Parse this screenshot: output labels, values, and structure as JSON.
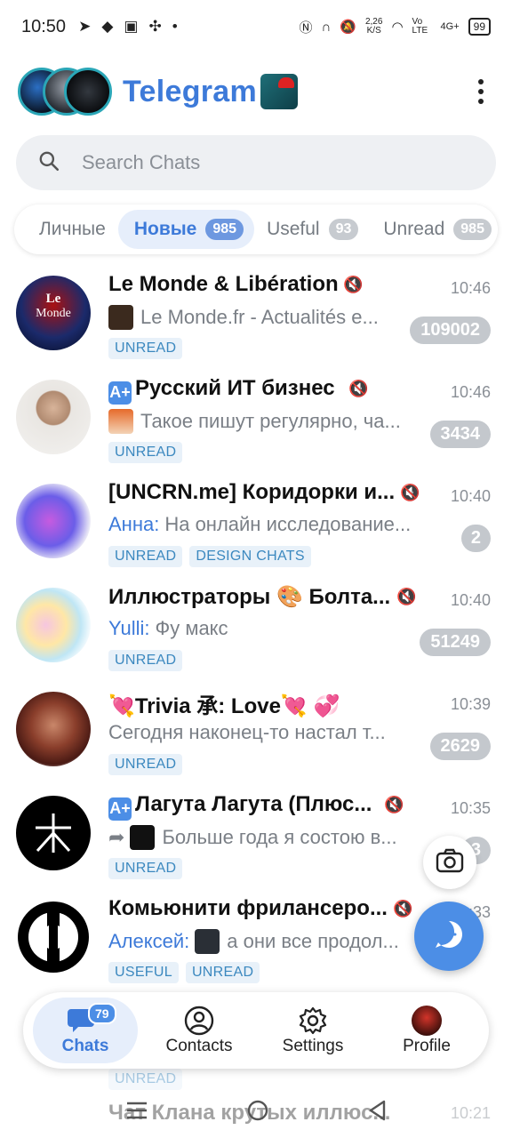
{
  "status_bar": {
    "time": "10:50",
    "speed_value": "2,26",
    "speed_unit": "K/S",
    "network": "Vo LTE",
    "signal": "4G+",
    "battery": "99"
  },
  "header": {
    "title": "Telegram"
  },
  "search": {
    "placeholder": "Search Chats"
  },
  "tabs": [
    {
      "label": "Личные",
      "count": ""
    },
    {
      "label": "Новые",
      "count": "985"
    },
    {
      "label": "Useful",
      "count": "93"
    },
    {
      "label": "Unread",
      "count": "985"
    }
  ],
  "chats": [
    {
      "title": "Le Monde & Libération",
      "time": "10:46",
      "sender": "",
      "preview": "Le Monde.fr - Actualités e...",
      "count": "109002",
      "labels": [
        "UNREAD"
      ]
    },
    {
      "title": "Русский ИТ бизнес",
      "time": "10:46",
      "sender": "",
      "preview": "Такое пишут регулярно, ча...",
      "count": "3434",
      "labels": [
        "UNREAD"
      ]
    },
    {
      "title": "[UNCRN.me] Коридорки и...",
      "time": "10:40",
      "sender": "Анна:",
      "preview": "На онлайн исследование...",
      "count": "2",
      "labels": [
        "UNREAD",
        "DESIGN CHATS"
      ]
    },
    {
      "title": "Иллюстраторы 🎨 Болта...",
      "time": "10:40",
      "sender": "Yulli:",
      "preview": "Фу макс",
      "count": "51249",
      "labels": [
        "UNREAD"
      ]
    },
    {
      "title": "💘Trivia 承: Love💘 💞",
      "time": "10:39",
      "sender": "",
      "preview": "Сегодня наконец-то настал т...",
      "count": "2629",
      "labels": [
        "UNREAD"
      ]
    },
    {
      "title": "Лагута Лагута (Плюс...",
      "time": "10:35",
      "sender": "",
      "preview": "Больше года я состою в...",
      "count": "3",
      "labels": [
        "UNREAD"
      ]
    },
    {
      "title": "Комьюнити фрилансеро...",
      "time": "10:33",
      "sender": "Алексей:",
      "preview": "а они все продол...",
      "count": "",
      "labels": [
        "USEFUL",
        "UNREAD"
      ]
    }
  ],
  "ghost_row": {
    "label": "UNREAD",
    "title": "Чат Клана крутых иллюс...",
    "time": "10:21"
  },
  "bottom_nav": {
    "chats_label": "Chats",
    "chats_badge": "79",
    "contacts_label": "Contacts",
    "settings_label": "Settings",
    "profile_label": "Profile"
  },
  "colors": {
    "accent": "#3d7ad9",
    "fab": "#4c8ee6",
    "label_text": "#3b88bf",
    "label_bg": "#e8f1f9",
    "muted_badge": "#c4c8cd"
  }
}
